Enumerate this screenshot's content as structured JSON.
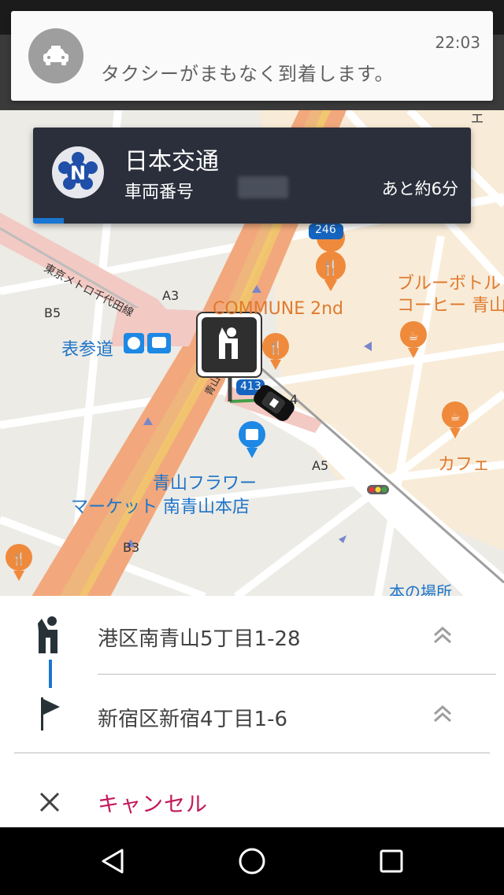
{
  "notification": {
    "message": "タクシーがまもなく到着します。",
    "time": "22:03",
    "icon": "taxi-icon"
  },
  "company": {
    "name": "日本交通",
    "vehicle_label": "車両番号",
    "eta": "あと約6分",
    "logo": "nihon-kotsu-logo",
    "progress": 0.07
  },
  "map": {
    "labels": {
      "station": "表参道",
      "line": "東京メトロ千代田線",
      "commune": "COMMUNE 2nd",
      "flower1": "青山フラワー",
      "flower2": "マーケット 南青山本店",
      "bluebottle1": "ブルーボトル",
      "bluebottle2": "コーヒー 青山",
      "cafe": "カフェ",
      "bookstore": "本の場所",
      "route246": "246",
      "route413": "413",
      "aoyama": "青山",
      "exit_a3": "A3",
      "exit_b5": "B5",
      "exit_a4": "4",
      "exit_a5": "A5",
      "exit_b3": "B3",
      "partial_top": "ェ"
    }
  },
  "route": {
    "pickup": "港区南青山5丁目1-28",
    "dropoff": "新宿区新宿4丁目1-6"
  },
  "actions": {
    "cancel": "キャンセル"
  },
  "colors": {
    "cancel": "#c2185b",
    "accent": "#1976d2",
    "card_bg": "#2b2f3b"
  }
}
